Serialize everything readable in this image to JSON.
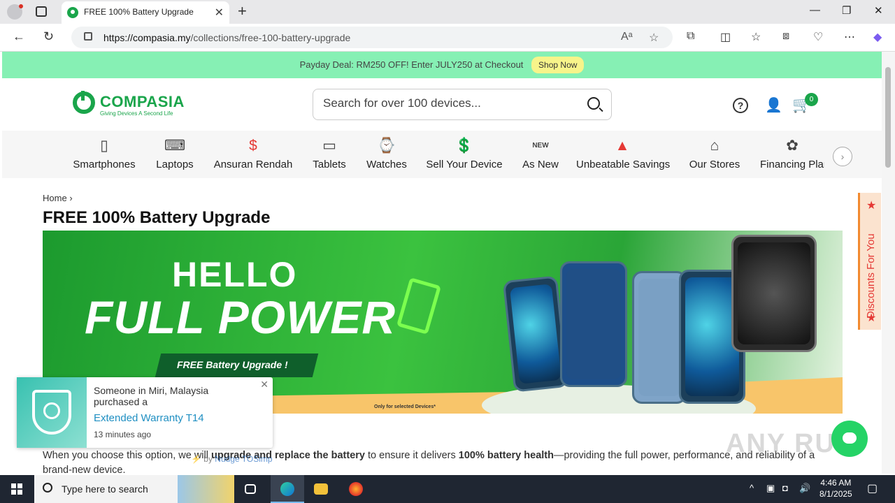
{
  "browser": {
    "tab_title": "FREE 100% Battery Upgrade",
    "url_host": "https://compasia.my",
    "url_path": "/collections/free-100-battery-upgrade"
  },
  "promo": {
    "text": "Payday Deal: RM250 OFF! Enter JULY250 at Checkout",
    "button": "Shop Now"
  },
  "header": {
    "logo_text": "COMPASIA",
    "logo_tagline": "Giving Devices A Second Life",
    "search_placeholder": "Search for over 100 devices...",
    "help_icon_glyph": "?",
    "cart_count": "0"
  },
  "categories": [
    {
      "label": "Smartphones",
      "icon": "smartphone-icon"
    },
    {
      "label": "Laptops",
      "icon": "laptop-icon"
    },
    {
      "label": "Ansuran Rendah",
      "icon": "installment-icon"
    },
    {
      "label": "Tablets",
      "icon": "tablet-icon"
    },
    {
      "label": "Watches",
      "icon": "watch-icon"
    },
    {
      "label": "Sell Your Device",
      "icon": "sell-device-icon"
    },
    {
      "label": "As New",
      "icon": "new-badge-icon"
    },
    {
      "label": "Unbeatable Savings",
      "icon": "savings-icon"
    },
    {
      "label": "Our Stores",
      "icon": "store-icon"
    },
    {
      "label": "Financing Plan",
      "icon": "financing-icon"
    }
  ],
  "breadcrumb": {
    "home": "Home"
  },
  "page_title": "FREE 100% Battery Upgrade",
  "banner": {
    "hello": "HELLO",
    "full_power": "FULL POWER",
    "ribbon": "FREE Battery Upgrade !",
    "note": "Only for selected Devices*"
  },
  "body": {
    "intro": "When you choose this option, we will ",
    "bold1": "upgrade and replace the battery",
    "mid": " to ensure it delivers ",
    "bold2": "100% battery health",
    "end": "—providing the full power, performance, and reliability of a brand-new device."
  },
  "side_tab": "Discounts For You",
  "toast": {
    "line1": "Someone in Miri, Malaysia",
    "line2": "purchased a",
    "product": "Extended Warranty T14",
    "time": "13 minutes ago",
    "credit_prefix": "⚡ by",
    "credit_name": "Nudge TOSimp"
  },
  "watermark": "ANY RUN",
  "taskbar": {
    "search_placeholder": "Type here to search",
    "time": "4:46 AM",
    "date": "8/1/2025"
  },
  "colors": {
    "brand_green": "#1aa54b",
    "promo_bg": "#86f0b4",
    "accent_red": "#e53935"
  }
}
